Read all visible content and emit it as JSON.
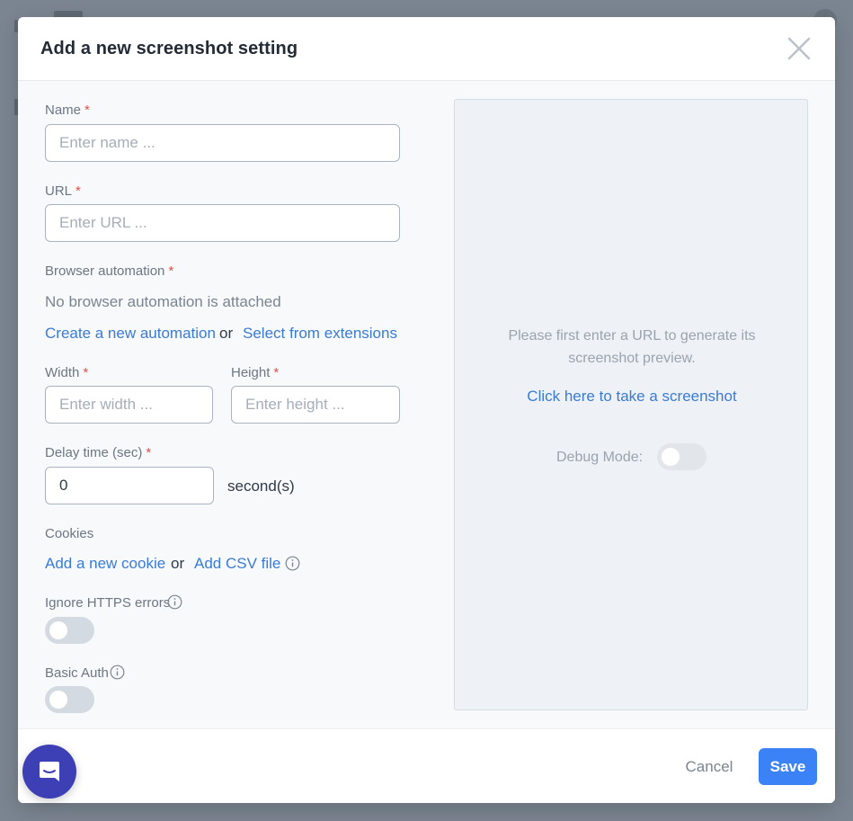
{
  "modal": {
    "title": "Add a new screenshot setting"
  },
  "form": {
    "name": {
      "label": "Name",
      "required": "*",
      "placeholder": "Enter name ..."
    },
    "url": {
      "label": "URL",
      "required": "*",
      "placeholder": "Enter URL ..."
    },
    "browser_automation": {
      "label": "Browser automation",
      "required": "*",
      "empty_text": "No browser automation is attached",
      "create_link": "Create a new automation",
      "or": "or",
      "select_link": "Select from extensions"
    },
    "width": {
      "label": "Width",
      "required": "*",
      "placeholder": "Enter width ..."
    },
    "height": {
      "label": "Height",
      "required": "*",
      "placeholder": "Enter height ..."
    },
    "delay": {
      "label": "Delay time (sec)",
      "required": "*",
      "value": "0",
      "unit": "second(s)"
    },
    "cookies": {
      "label": "Cookies",
      "add_cookie_link": "Add a new cookie",
      "or": "or",
      "add_csv_link": "Add CSV file"
    },
    "ignore_https": {
      "label": "Ignore HTTPS errors",
      "enabled": false
    },
    "basic_auth": {
      "label": "Basic Auth",
      "enabled": false
    }
  },
  "preview": {
    "message": "Please first enter a URL to generate its screenshot preview.",
    "take_screenshot_link": "Click here to take a screenshot",
    "debug_label": "Debug Mode:",
    "debug_enabled": false
  },
  "footer": {
    "cancel_label": "Cancel",
    "save_label": "Save"
  },
  "colors": {
    "accent": "#3b82f6",
    "link": "#3a7bd5",
    "required": "#e0504a",
    "overlay": "#7b8591",
    "chat_launcher": "#3d3fb5"
  },
  "icons": {
    "close": "close-icon",
    "info": "info-icon",
    "chat": "chat-icon"
  }
}
